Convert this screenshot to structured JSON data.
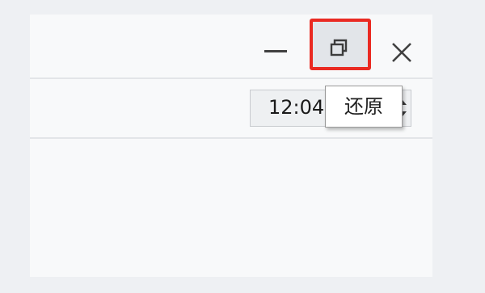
{
  "titlebar": {
    "minimize_icon": "minimize-icon",
    "restore_icon": "restore-icon",
    "close_icon": "close-icon",
    "highlight_color": "#ea2a22"
  },
  "time_field": {
    "value": "12:04"
  },
  "tooltip": {
    "text": "还原"
  }
}
